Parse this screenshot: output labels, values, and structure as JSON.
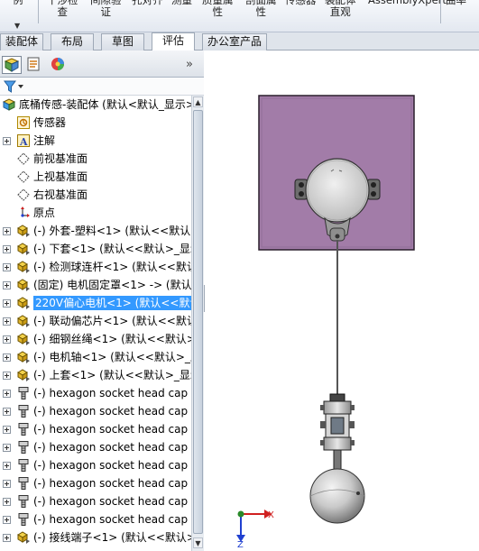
{
  "ribbon": {
    "buttons": [
      {
        "line1": "例",
        "line2": ""
      },
      {
        "line1": "干涉检",
        "line2": "查"
      },
      {
        "line1": "间隙验",
        "line2": "证"
      },
      {
        "line1": "孔对齐",
        "line2": ""
      },
      {
        "line1": "测量",
        "line2": ""
      },
      {
        "line1": "质量属",
        "line2": "性"
      },
      {
        "line1": "剖面属",
        "line2": "性"
      },
      {
        "line1": "传感器",
        "line2": ""
      },
      {
        "line1": "装配体",
        "line2": "直观"
      },
      {
        "line1": "AssemblyXpert",
        "line2": ""
      },
      {
        "line1": "曲率",
        "line2": ""
      }
    ]
  },
  "tabs": [
    "装配体",
    "布局",
    "草图",
    "评估",
    "办公室产品"
  ],
  "active_tab": "评估",
  "panel": {
    "chevron": "»",
    "tree": [
      {
        "label": "底桶传感-装配体  (默认<默认_显示>",
        "icon": "assembly-icon",
        "expander": false,
        "indent": 0
      },
      {
        "label": "传感器",
        "icon": "sensor-icon",
        "expander": false,
        "indent": 1
      },
      {
        "label": "注解",
        "icon": "annotation-icon",
        "expander": true,
        "indent": 1
      },
      {
        "label": "前视基准面",
        "icon": "plane-icon",
        "expander": false,
        "indent": 1
      },
      {
        "label": "上视基准面",
        "icon": "plane-icon",
        "expander": false,
        "indent": 1
      },
      {
        "label": "右视基准面",
        "icon": "plane-icon",
        "expander": false,
        "indent": 1
      },
      {
        "label": "原点",
        "icon": "origin-icon",
        "expander": false,
        "indent": 1
      },
      {
        "label": "(-) 外套-塑料<1> (默认<<默认",
        "icon": "part-icon",
        "expander": true,
        "indent": 1
      },
      {
        "label": "(-) 下套<1> (默认<<默认>_显示",
        "icon": "part-icon",
        "expander": true,
        "indent": 1
      },
      {
        "label": "(-) 检测球连杆<1> (默认<<默认",
        "icon": "part-icon",
        "expander": true,
        "indent": 1
      },
      {
        "label": "(固定) 电机固定罩<1> -> (默认",
        "icon": "part-icon",
        "expander": true,
        "indent": 1
      },
      {
        "label": "220V偏心电机<1> (默认<<默认",
        "icon": "part-icon",
        "expander": true,
        "indent": 1,
        "selected": true
      },
      {
        "label": "(-) 联动偏芯片<1> (默认<<默认",
        "icon": "part-icon",
        "expander": true,
        "indent": 1
      },
      {
        "label": "(-) 细钢丝绳<1> (默认<<默认>",
        "icon": "part-icon",
        "expander": true,
        "indent": 1
      },
      {
        "label": "(-) 电机轴<1> (默认<<默认>_显",
        "icon": "part-icon",
        "expander": true,
        "indent": 1
      },
      {
        "label": "(-) 上套<1> (默认<<默认>_显示",
        "icon": "part-icon",
        "expander": true,
        "indent": 1
      },
      {
        "label": "(-) hexagon socket head cap",
        "icon": "screw-icon",
        "expander": true,
        "indent": 1
      },
      {
        "label": "(-) hexagon socket head cap",
        "icon": "screw-icon",
        "expander": true,
        "indent": 1
      },
      {
        "label": "(-) hexagon socket head cap",
        "icon": "screw-icon",
        "expander": true,
        "indent": 1
      },
      {
        "label": "(-) hexagon socket head cap",
        "icon": "screw-icon",
        "expander": true,
        "indent": 1
      },
      {
        "label": "(-) hexagon socket head cap",
        "icon": "screw-icon",
        "expander": true,
        "indent": 1
      },
      {
        "label": "(-) hexagon socket head cap",
        "icon": "screw-icon",
        "expander": true,
        "indent": 1
      },
      {
        "label": "(-) hexagon socket head cap",
        "icon": "screw-icon",
        "expander": true,
        "indent": 1
      },
      {
        "label": "(-) hexagon socket head cap",
        "icon": "screw-icon",
        "expander": true,
        "indent": 1
      },
      {
        "label": "(-) 接线端子<1> (默认<<默认>",
        "icon": "part-icon",
        "expander": true,
        "indent": 1
      }
    ]
  },
  "triad": {
    "x": "X",
    "y": "Y",
    "z": "Z"
  },
  "colors": {
    "housing_purple": "#a27ca8",
    "selection_blue": "#3399ff",
    "axis_red": "#d02020",
    "axis_green": "#2a8a2a",
    "axis_blue": "#2040d0"
  }
}
